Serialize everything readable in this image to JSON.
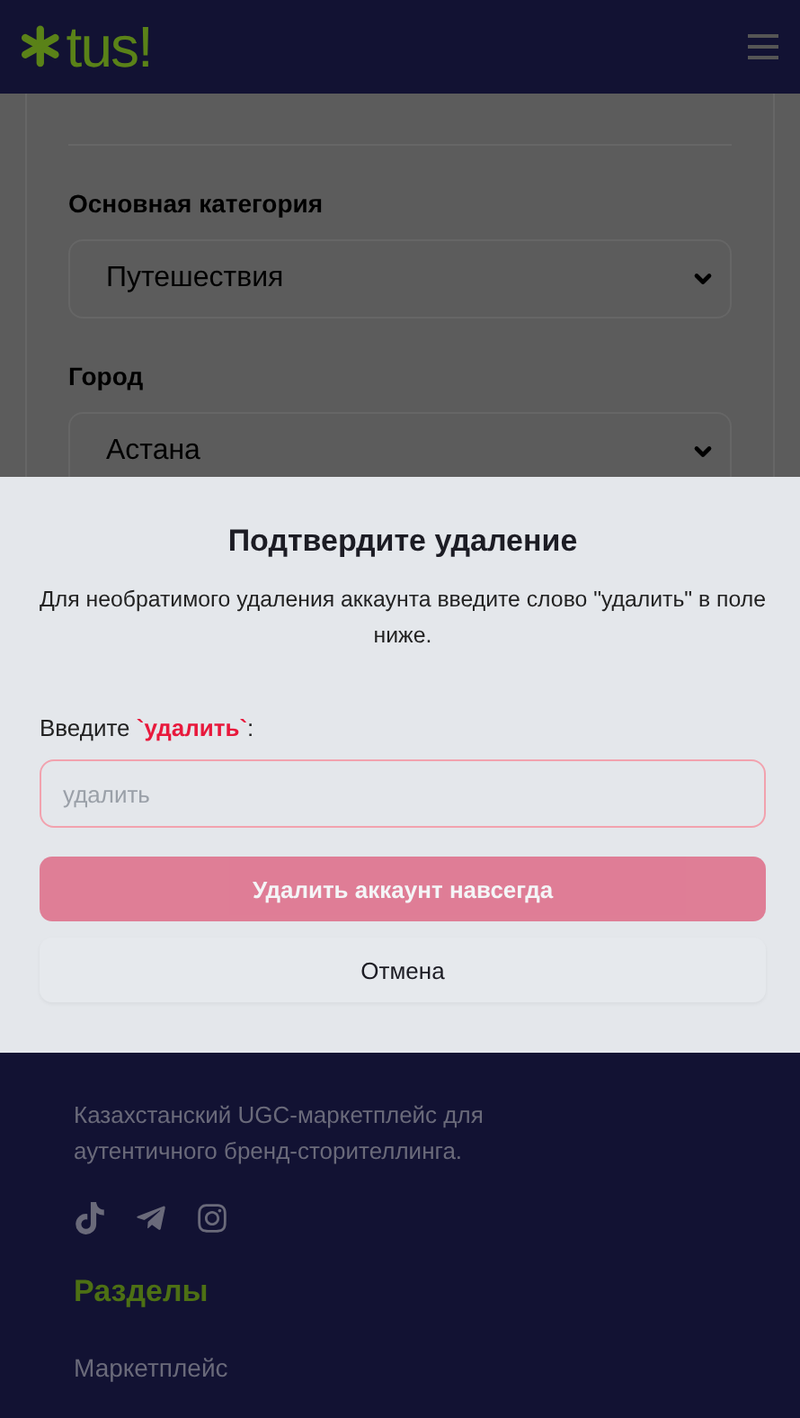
{
  "header": {
    "logo": "tus!"
  },
  "section": {
    "fields": [
      {
        "label": "Основная категория",
        "value": "Путешествия"
      },
      {
        "label": "Город",
        "value": "Астана"
      }
    ]
  },
  "dialog": {
    "title": "Подтвердите удаление",
    "message": "Для необратимого удаления аккаунта введите слово \"удалить\" в поле ниже.",
    "prompt": "Введите **`удалить`**:",
    "input": {
      "placeholder": "удалить"
    },
    "buttons": [
      {
        "label": "Удалить аккаунт навсегда",
        "kind": "danger",
        "disabled": true
      },
      {
        "label": "Отмена",
        "kind": "secondary",
        "disabled": false
      }
    ]
  },
  "footer": {
    "tagline": "Казахстанский UGC-маркетплейс для аутентичного бренд-сторителлинга.",
    "sections_title": "Разделы",
    "links": [
      "Маркетплейс"
    ]
  }
}
